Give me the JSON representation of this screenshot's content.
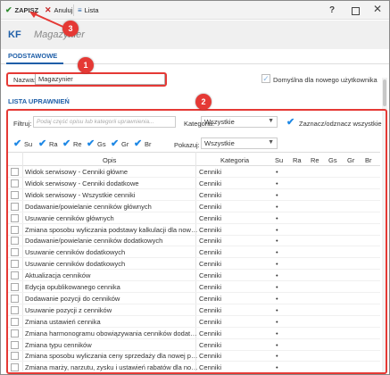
{
  "toolbar": {
    "save_label": "ZAPISZ",
    "cancel_label": "Anuluj",
    "list_label": "Lista",
    "save_icon": "✔",
    "cancel_icon": "✕",
    "list_icon": "≡",
    "help_label": "?"
  },
  "header": {
    "logo": "KF",
    "title": "Magazynier"
  },
  "tabs": [
    {
      "label": "PODSTAWOWE",
      "active": true
    }
  ],
  "form": {
    "name_label": "Nazwa:",
    "name_value": "Magazynier",
    "default_label": "Domyślna dla nowego użytkownika",
    "default_checked": true
  },
  "permissions": {
    "section_title": "LISTA UPRAWNIEŃ",
    "filter_label": "Filtruj:",
    "filter_placeholder": "Podaj część opisu lub kategorii uprawnienia...",
    "category_label": "Kategoria:",
    "category_value": "Wszystkie",
    "toggle_all_label": "Zaznacz/odznacz wszystkie",
    "toggle_all_checked": true,
    "show_label": "Pokazuj:",
    "show_value": "Wszystkie",
    "rights_filters": [
      {
        "label": "Su",
        "checked": true
      },
      {
        "label": "Ra",
        "checked": true
      },
      {
        "label": "Re",
        "checked": true
      },
      {
        "label": "Gs",
        "checked": true
      },
      {
        "label": "Gr",
        "checked": true
      },
      {
        "label": "Br",
        "checked": true
      }
    ],
    "columns": [
      "Opis",
      "Kategoria",
      "Su",
      "Ra",
      "Re",
      "Gs",
      "Gr",
      "Br"
    ],
    "rows": [
      {
        "opis": "Widok serwisowy - Cenniki główne",
        "kategoria": "Cenniki",
        "su": "•"
      },
      {
        "opis": "Widok serwisowy - Cenniki dodatkowe",
        "kategoria": "Cenniki",
        "su": "•"
      },
      {
        "opis": "Widok serwisowy - Wszystkie cenniki",
        "kategoria": "Cenniki",
        "su": "•"
      },
      {
        "opis": "Dodawanie/powielanie cenników głównych",
        "kategoria": "Cenniki",
        "su": "•"
      },
      {
        "opis": "Usuwanie cenników głównych",
        "kategoria": "Cenniki",
        "su": "•"
      },
      {
        "opis": "Zmiana sposobu wyliczania podstawy kalkulacji dla nowej p...",
        "kategoria": "Cenniki",
        "su": "•"
      },
      {
        "opis": "Dodawanie/powielanie cenników dodatkowych",
        "kategoria": "Cenniki",
        "su": "•"
      },
      {
        "opis": "Usuwanie cenników dodatkowych",
        "kategoria": "Cenniki",
        "su": "•"
      },
      {
        "opis": "Usuwanie cenników dodatkowych",
        "kategoria": "Cenniki",
        "su": "•"
      },
      {
        "opis": "Aktualizacja cenników",
        "kategoria": "Cenniki",
        "su": "•"
      },
      {
        "opis": "Edycja opublikowanego cennika",
        "kategoria": "Cenniki",
        "su": "•"
      },
      {
        "opis": "Dodawanie pozycji do cenników",
        "kategoria": "Cenniki",
        "su": "•"
      },
      {
        "opis": "Usuwanie pozycji z cenników",
        "kategoria": "Cenniki",
        "su": "•"
      },
      {
        "opis": "Zmiana ustawień cennika",
        "kategoria": "Cenniki",
        "su": "•"
      },
      {
        "opis": "Zmiana harmonogramu obowiązywania cenników dodatkow...",
        "kategoria": "Cenniki",
        "su": "•"
      },
      {
        "opis": "Zmiana typu cenników",
        "kategoria": "Cenniki",
        "su": "•"
      },
      {
        "opis": "Zmiana sposobu wyliczania ceny sprzedaży dla nowej pozycji",
        "kategoria": "Cenniki",
        "su": "•"
      },
      {
        "opis": "Zmiana marży, narzutu, zysku i ustawień rabatów dla nowej...",
        "kategoria": "Cenniki",
        "su": "•"
      }
    ]
  },
  "annotations": [
    "1",
    "2",
    "3"
  ],
  "colors": {
    "accent": "#1f5fa8",
    "annotation": "#e53935",
    "save_icon": "#2e8b2e",
    "cancel_icon": "#c62828",
    "checkbox": "#1e88e5"
  }
}
